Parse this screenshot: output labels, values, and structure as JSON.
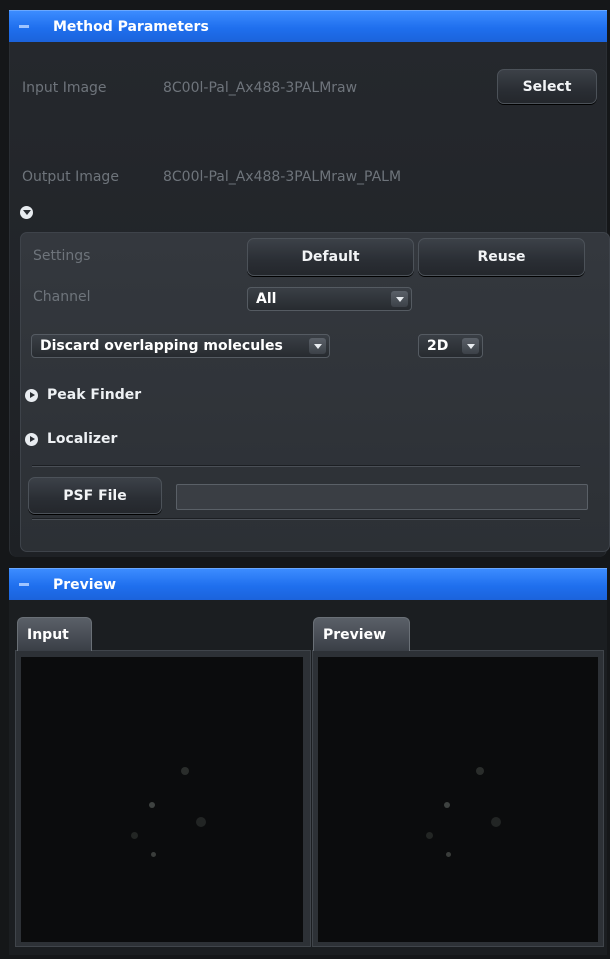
{
  "method_parameters": {
    "title": "Method Parameters",
    "input_image_label": "Input Image",
    "input_image_value": "8C00l-Pal_Ax488-3PALMraw",
    "select_label": "Select",
    "output_image_label": "Output Image",
    "output_image_value": "8C00l-Pal_Ax488-3PALMraw_PALM",
    "settings": {
      "settings_label": "Settings",
      "default_label": "Default",
      "reuse_label": "Reuse",
      "channel_label": "Channel",
      "channel_value": "All",
      "discard_value": "Discard overlapping molecules",
      "dimension_value": "2D",
      "peak_finder_label": "Peak Finder",
      "localizer_label": "Localizer",
      "psf_file_label": "PSF File",
      "psf_file_value": ""
    }
  },
  "preview": {
    "title": "Preview",
    "input_tab_label": "Input",
    "preview_tab_label": "Preview"
  },
  "colors": {
    "header_blue": "#1f6fee",
    "panel_bg": "#25282d",
    "button_bg": "#2a2e34"
  }
}
